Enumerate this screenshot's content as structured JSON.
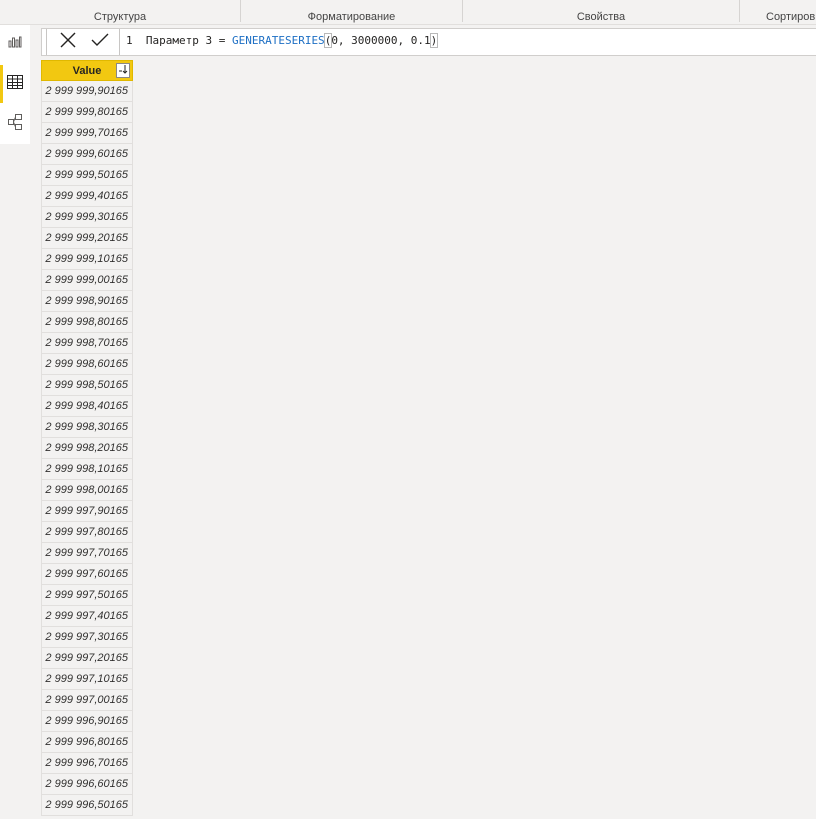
{
  "ribbon": {
    "groups": [
      {
        "label": "Структура"
      },
      {
        "label": "Форматирование"
      },
      {
        "label": "Свойства"
      },
      {
        "label": "Сортировка"
      }
    ]
  },
  "sidebar": {
    "items": [
      {
        "icon": "report-view-icon"
      },
      {
        "icon": "data-view-icon",
        "active": true
      },
      {
        "icon": "model-view-icon"
      }
    ]
  },
  "formula_bar": {
    "line_number": "1",
    "prefix": "Параметр 3 = ",
    "function": "GENERATESERIES",
    "open_paren": "(",
    "args": "0, 3000000, 0.1",
    "close_paren": ")"
  },
  "table": {
    "column_header": "Value",
    "rows": [
      "2 999 999,90165",
      "2 999 999,80165",
      "2 999 999,70165",
      "2 999 999,60165",
      "2 999 999,50165",
      "2 999 999,40165",
      "2 999 999,30165",
      "2 999 999,20165",
      "2 999 999,10165",
      "2 999 999,00165",
      "2 999 998,90165",
      "2 999 998,80165",
      "2 999 998,70165",
      "2 999 998,60165",
      "2 999 998,50165",
      "2 999 998,40165",
      "2 999 998,30165",
      "2 999 998,20165",
      "2 999 998,10165",
      "2 999 998,00165",
      "2 999 997,90165",
      "2 999 997,80165",
      "2 999 997,70165",
      "2 999 997,60165",
      "2 999 997,50165",
      "2 999 997,40165",
      "2 999 997,30165",
      "2 999 997,20165",
      "2 999 997,10165",
      "2 999 997,00165",
      "2 999 996,90165",
      "2 999 996,80165",
      "2 999 996,70165",
      "2 999 996,60165",
      "2 999 996,50165"
    ]
  },
  "colors": {
    "accent": "#f2c811",
    "function_blue": "#1d6fc4",
    "background": "#f3f2f1"
  }
}
